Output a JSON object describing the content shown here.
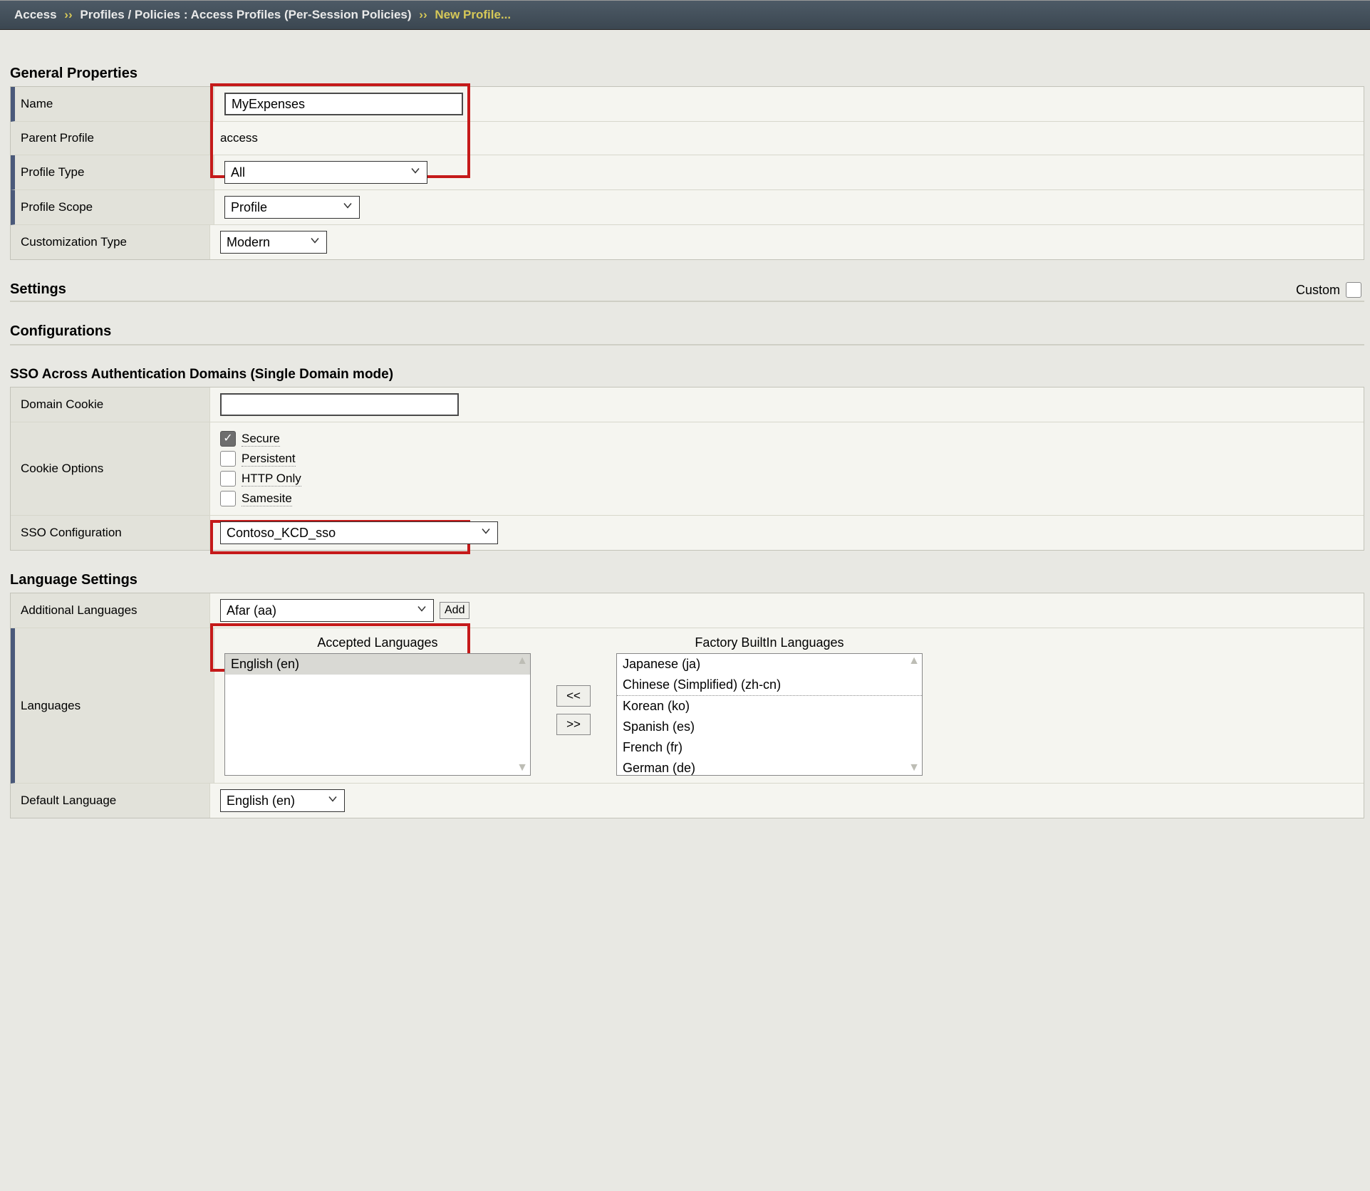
{
  "breadcrumb": {
    "seg1": "Access",
    "sep": "››",
    "seg2": "Profiles / Policies : Access Profiles (Per-Session Policies)",
    "current": "New Profile..."
  },
  "sections": {
    "general": "General Properties",
    "settings": "Settings",
    "configurations": "Configurations",
    "ssoDomains": "SSO Across Authentication Domains (Single Domain mode)",
    "language": "Language Settings"
  },
  "general": {
    "nameLabel": "Name",
    "nameValue": "MyExpenses",
    "parentProfileLabel": "Parent Profile",
    "parentProfileValue": "access",
    "profileTypeLabel": "Profile Type",
    "profileTypeValue": "All",
    "profileScopeLabel": "Profile Scope",
    "profileScopeValue": "Profile",
    "customizationTypeLabel": "Customization Type",
    "customizationTypeValue": "Modern"
  },
  "settings": {
    "customLabel": "Custom"
  },
  "sso": {
    "domainCookieLabel": "Domain Cookie",
    "domainCookieValue": "",
    "cookieOptionsLabel": "Cookie Options",
    "opts": {
      "secure": {
        "label": "Secure",
        "checked": true
      },
      "persistent": {
        "label": "Persistent",
        "checked": false
      },
      "httpOnly": {
        "label": "HTTP Only",
        "checked": false
      },
      "samesite": {
        "label": "Samesite",
        "checked": false
      }
    },
    "ssoConfigLabel": "SSO Configuration",
    "ssoConfigValue": "Contoso_KCD_sso"
  },
  "lang": {
    "additionalLabel": "Additional Languages",
    "additionalValue": "Afar (aa)",
    "addButton": "Add",
    "languagesLabel": "Languages",
    "acceptedTitle": "Accepted Languages",
    "factoryTitle": "Factory BuiltIn Languages",
    "accepted": [
      "English (en)"
    ],
    "factory": [
      "Japanese (ja)",
      "Chinese (Simplified) (zh-cn)",
      "Korean (ko)",
      "Spanish (es)",
      "French (fr)",
      "German (de)"
    ],
    "moveLeft": "<<",
    "moveRight": ">>",
    "defaultLabel": "Default Language",
    "defaultValue": "English (en)"
  }
}
